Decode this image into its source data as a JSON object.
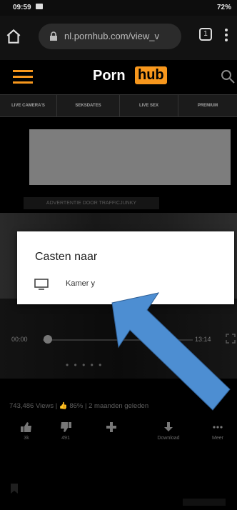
{
  "status": {
    "time": "09:59",
    "battery": "72%"
  },
  "browser": {
    "url": "nl.pornhub.com/view_v",
    "tab_count": "1"
  },
  "site": {
    "logo_part1": "Porn",
    "logo_part2": "hub",
    "nav": [
      "LIVE CAMERA'S",
      "SEKSDATES",
      "LIVE SEX",
      "PREMIUM"
    ]
  },
  "ad": {
    "label": "ADVERTENTIE DOOR TRAFFICJUNKY"
  },
  "player": {
    "current_time": "00:00",
    "total_time": "13:14",
    "dots": "• • • • •"
  },
  "cast_dialog": {
    "title": "Casten naar",
    "device_name": "Kamer y"
  },
  "video_stats": {
    "text": "743,486 Views | 👍 86% | 2 maanden geleden"
  },
  "actions": {
    "like": {
      "label": "3k"
    },
    "dislike": {
      "label": "491"
    },
    "add": {
      "label": ""
    },
    "download": {
      "label": "Download"
    },
    "more": {
      "label": "Meer"
    }
  },
  "colors": {
    "accent": "#f7971d",
    "arrow": "#4d8ed2",
    "dialog_bg": "#ffffff"
  }
}
